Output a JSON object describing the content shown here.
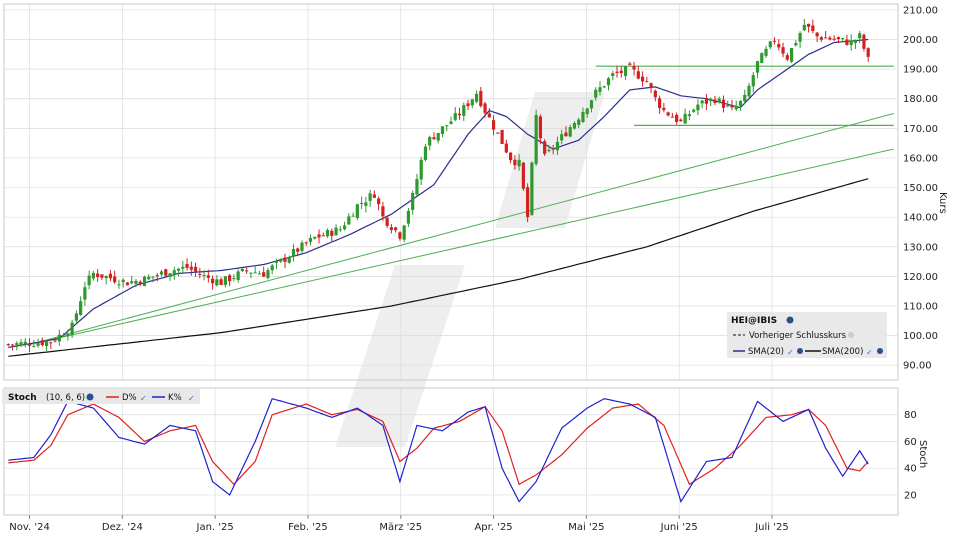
{
  "chart_data": [
    {
      "type": "candlestick",
      "symbol": "HEI@IBIS",
      "ylabel": "Kurs",
      "ylim": [
        85,
        212
      ],
      "yticks": [
        "90.00",
        "100.00",
        "110.00",
        "120.00",
        "130.00",
        "140.00",
        "150.00",
        "160.00",
        "170.00",
        "180.00",
        "190.00",
        "200.00",
        "210.00"
      ],
      "xticks": [
        "Nov. '24",
        "Dez. '24",
        "Jan. '25",
        "Feb. '25",
        "März '25",
        "Apr. '25",
        "Mai '25",
        "Juni '25",
        "Juli '25"
      ],
      "legend": {
        "symbol": "HEI@IBIS",
        "prev_close_label": "Vorheriger Schlusskurs",
        "sma20_label": "SMA(20)",
        "sma200_label": "SMA(200)",
        "position": "bottom-right"
      },
      "colors": {
        "up": "#2e9a2e",
        "down": "#d42020",
        "sma20": "#2a2f8f",
        "sma200": "#111111",
        "trendline": "#4caf50",
        "grid": "#dcdcdc"
      },
      "close_anchors": [
        {
          "day": 0,
          "close": 97
        },
        {
          "day": 10,
          "close": 98
        },
        {
          "day": 12,
          "close": 100
        },
        {
          "day": 15,
          "close": 103
        },
        {
          "day": 18,
          "close": 117
        },
        {
          "day": 20,
          "close": 121
        },
        {
          "day": 28,
          "close": 118
        },
        {
          "day": 32,
          "close": 119
        },
        {
          "day": 38,
          "close": 122
        },
        {
          "day": 42,
          "close": 123
        },
        {
          "day": 46,
          "close": 120
        },
        {
          "day": 50,
          "close": 118
        },
        {
          "day": 56,
          "close": 122
        },
        {
          "day": 60,
          "close": 121
        },
        {
          "day": 65,
          "close": 126
        },
        {
          "day": 72,
          "close": 133
        },
        {
          "day": 78,
          "close": 136
        },
        {
          "day": 82,
          "close": 144
        },
        {
          "day": 86,
          "close": 148
        },
        {
          "day": 88,
          "close": 140
        },
        {
          "day": 92,
          "close": 134
        },
        {
          "day": 95,
          "close": 147
        },
        {
          "day": 98,
          "close": 165
        },
        {
          "day": 102,
          "close": 170
        },
        {
          "day": 106,
          "close": 175
        },
        {
          "day": 110,
          "close": 182
        },
        {
          "day": 112,
          "close": 176
        },
        {
          "day": 115,
          "close": 168
        },
        {
          "day": 118,
          "close": 160
        },
        {
          "day": 120,
          "close": 158
        },
        {
          "day": 122,
          "close": 140
        },
        {
          "day": 124,
          "close": 174
        },
        {
          "day": 126,
          "close": 160
        },
        {
          "day": 130,
          "close": 167
        },
        {
          "day": 134,
          "close": 174
        },
        {
          "day": 138,
          "close": 182
        },
        {
          "day": 142,
          "close": 188
        },
        {
          "day": 146,
          "close": 190
        },
        {
          "day": 150,
          "close": 186
        },
        {
          "day": 152,
          "close": 180
        },
        {
          "day": 154,
          "close": 176
        },
        {
          "day": 158,
          "close": 172
        },
        {
          "day": 162,
          "close": 178
        },
        {
          "day": 166,
          "close": 180
        },
        {
          "day": 170,
          "close": 176
        },
        {
          "day": 173,
          "close": 180
        },
        {
          "day": 176,
          "close": 192
        },
        {
          "day": 180,
          "close": 200
        },
        {
          "day": 183,
          "close": 194
        },
        {
          "day": 187,
          "close": 205
        },
        {
          "day": 190,
          "close": 201
        },
        {
          "day": 194,
          "close": 200
        },
        {
          "day": 198,
          "close": 199
        },
        {
          "day": 200,
          "close": 201
        },
        {
          "day": 202,
          "close": 193
        }
      ],
      "sma20_anchors": [
        {
          "day": 0,
          "value": 96
        },
        {
          "day": 12,
          "value": 99
        },
        {
          "day": 20,
          "value": 109
        },
        {
          "day": 30,
          "value": 117
        },
        {
          "day": 40,
          "value": 121
        },
        {
          "day": 50,
          "value": 122
        },
        {
          "day": 60,
          "value": 124
        },
        {
          "day": 70,
          "value": 128
        },
        {
          "day": 80,
          "value": 134
        },
        {
          "day": 90,
          "value": 141
        },
        {
          "day": 100,
          "value": 151
        },
        {
          "day": 108,
          "value": 168
        },
        {
          "day": 113,
          "value": 176
        },
        {
          "day": 117,
          "value": 174
        },
        {
          "day": 122,
          "value": 168
        },
        {
          "day": 128,
          "value": 163
        },
        {
          "day": 134,
          "value": 166
        },
        {
          "day": 140,
          "value": 174
        },
        {
          "day": 146,
          "value": 183
        },
        {
          "day": 152,
          "value": 184
        },
        {
          "day": 158,
          "value": 181
        },
        {
          "day": 164,
          "value": 180
        },
        {
          "day": 172,
          "value": 177
        },
        {
          "day": 176,
          "value": 183
        },
        {
          "day": 182,
          "value": 189
        },
        {
          "day": 188,
          "value": 195
        },
        {
          "day": 194,
          "value": 199
        },
        {
          "day": 202,
          "value": 200
        }
      ],
      "sma200_anchors": [
        {
          "day": 0,
          "value": 93
        },
        {
          "day": 50,
          "value": 101
        },
        {
          "day": 90,
          "value": 110
        },
        {
          "day": 120,
          "value": 119
        },
        {
          "day": 150,
          "value": 130
        },
        {
          "day": 175,
          "value": 142
        },
        {
          "day": 202,
          "value": 153
        }
      ],
      "horizontal_lines": [
        {
          "from_day": 138,
          "to_day": 208,
          "value": 191
        },
        {
          "from_day": 147,
          "to_day": 208,
          "value": 171
        }
      ],
      "trend_lines": [
        {
          "from_day": 5,
          "from_value": 97,
          "to_day": 208,
          "to_value": 175
        },
        {
          "from_day": 5,
          "from_value": 97,
          "to_day": 208,
          "to_value": 163
        }
      ]
    },
    {
      "type": "line",
      "title": "Stoch",
      "params": "(10, 6, 6)",
      "ylabel": "Stoch",
      "ylim": [
        5,
        100
      ],
      "yticks": [
        "20",
        "40",
        "60",
        "80"
      ],
      "series": [
        {
          "name": "D%",
          "color": "#e02020",
          "anchors": [
            {
              "day": 0,
              "value": 44
            },
            {
              "day": 6,
              "value": 46
            },
            {
              "day": 10,
              "value": 57
            },
            {
              "day": 14,
              "value": 80
            },
            {
              "day": 20,
              "value": 88
            },
            {
              "day": 26,
              "value": 78
            },
            {
              "day": 32,
              "value": 60
            },
            {
              "day": 38,
              "value": 68
            },
            {
              "day": 44,
              "value": 72
            },
            {
              "day": 48,
              "value": 45
            },
            {
              "day": 53,
              "value": 28
            },
            {
              "day": 58,
              "value": 45
            },
            {
              "day": 62,
              "value": 80
            },
            {
              "day": 70,
              "value": 88
            },
            {
              "day": 76,
              "value": 80
            },
            {
              "day": 82,
              "value": 84
            },
            {
              "day": 88,
              "value": 75
            },
            {
              "day": 92,
              "value": 45
            },
            {
              "day": 96,
              "value": 55
            },
            {
              "day": 100,
              "value": 70
            },
            {
              "day": 106,
              "value": 75
            },
            {
              "day": 112,
              "value": 86
            },
            {
              "day": 116,
              "value": 68
            },
            {
              "day": 120,
              "value": 28
            },
            {
              "day": 124,
              "value": 35
            },
            {
              "day": 130,
              "value": 50
            },
            {
              "day": 136,
              "value": 70
            },
            {
              "day": 142,
              "value": 85
            },
            {
              "day": 148,
              "value": 88
            },
            {
              "day": 154,
              "value": 72
            },
            {
              "day": 160,
              "value": 28
            },
            {
              "day": 166,
              "value": 40
            },
            {
              "day": 172,
              "value": 57
            },
            {
              "day": 178,
              "value": 78
            },
            {
              "day": 184,
              "value": 80
            },
            {
              "day": 188,
              "value": 84
            },
            {
              "day": 192,
              "value": 72
            },
            {
              "day": 197,
              "value": 40
            },
            {
              "day": 200,
              "value": 38
            },
            {
              "day": 202,
              "value": 45
            }
          ]
        },
        {
          "name": "K%",
          "color": "#2020d0",
          "anchors": [
            {
              "day": 0,
              "value": 46
            },
            {
              "day": 6,
              "value": 48
            },
            {
              "day": 10,
              "value": 65
            },
            {
              "day": 14,
              "value": 90
            },
            {
              "day": 20,
              "value": 85
            },
            {
              "day": 26,
              "value": 63
            },
            {
              "day": 32,
              "value": 58
            },
            {
              "day": 38,
              "value": 72
            },
            {
              "day": 44,
              "value": 68
            },
            {
              "day": 48,
              "value": 30
            },
            {
              "day": 52,
              "value": 20
            },
            {
              "day": 58,
              "value": 60
            },
            {
              "day": 62,
              "value": 92
            },
            {
              "day": 70,
              "value": 85
            },
            {
              "day": 76,
              "value": 78
            },
            {
              "day": 82,
              "value": 85
            },
            {
              "day": 88,
              "value": 72
            },
            {
              "day": 92,
              "value": 30
            },
            {
              "day": 96,
              "value": 72
            },
            {
              "day": 102,
              "value": 68
            },
            {
              "day": 108,
              "value": 82
            },
            {
              "day": 112,
              "value": 86
            },
            {
              "day": 116,
              "value": 40
            },
            {
              "day": 120,
              "value": 15
            },
            {
              "day": 124,
              "value": 30
            },
            {
              "day": 130,
              "value": 70
            },
            {
              "day": 136,
              "value": 85
            },
            {
              "day": 140,
              "value": 92
            },
            {
              "day": 146,
              "value": 88
            },
            {
              "day": 152,
              "value": 78
            },
            {
              "day": 158,
              "value": 15
            },
            {
              "day": 164,
              "value": 45
            },
            {
              "day": 170,
              "value": 48
            },
            {
              "day": 176,
              "value": 90
            },
            {
              "day": 182,
              "value": 75
            },
            {
              "day": 188,
              "value": 84
            },
            {
              "day": 192,
              "value": 55
            },
            {
              "day": 196,
              "value": 34
            },
            {
              "day": 200,
              "value": 53
            },
            {
              "day": 202,
              "value": 43
            }
          ]
        }
      ]
    }
  ],
  "watermark_icon": "brand-logo-watermark"
}
